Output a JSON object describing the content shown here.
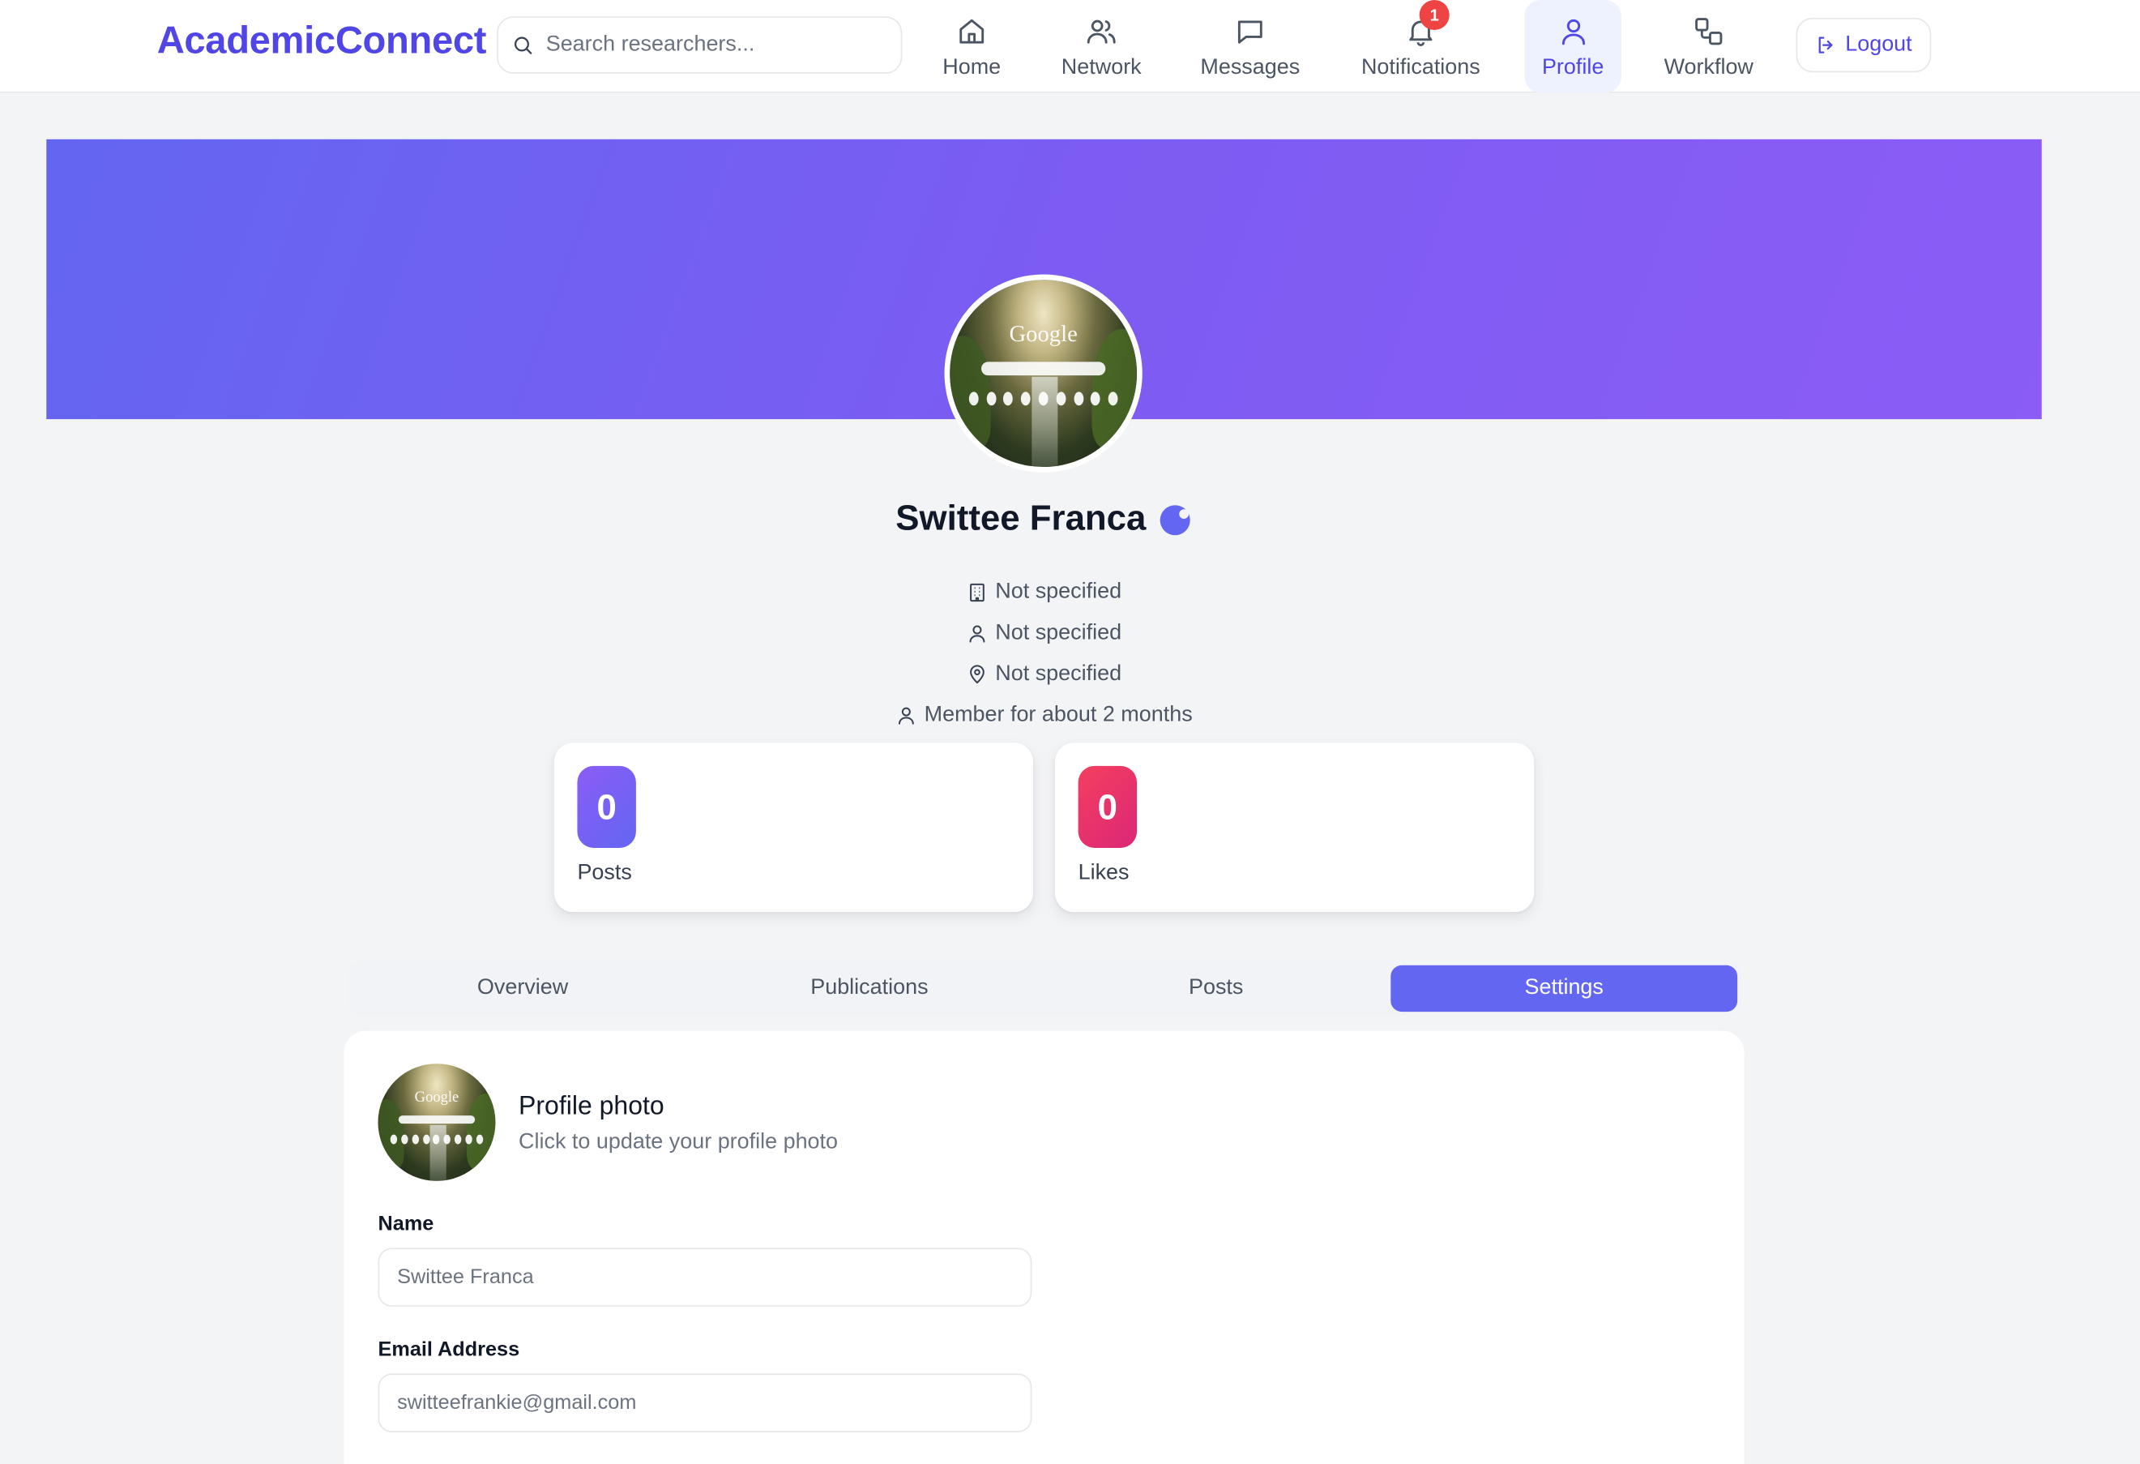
{
  "app": {
    "brand": "AcademicConnect"
  },
  "search": {
    "placeholder": "Search researchers..."
  },
  "nav": {
    "items": [
      {
        "label": "Home",
        "icon": "home-icon"
      },
      {
        "label": "Network",
        "icon": "users-icon"
      },
      {
        "label": "Messages",
        "icon": "message-icon"
      },
      {
        "label": "Notifications",
        "icon": "bell-icon",
        "badge": "1"
      },
      {
        "label": "Profile",
        "icon": "user-icon",
        "active": true
      },
      {
        "label": "Workflow",
        "icon": "workflow-icon"
      }
    ],
    "logout_label": "Logout"
  },
  "profile": {
    "photo_text": "Google",
    "name": "Swittee Franca",
    "verified_icon": "verified-badge-icon",
    "institution": "Not specified",
    "position": "Not specified",
    "location": "Not specified",
    "member_since": "Member for about 2 months"
  },
  "stats": [
    {
      "value": "0",
      "label": "Posts",
      "color_from": "#8b5cf6",
      "color_to": "#6366f1"
    },
    {
      "value": "0",
      "label": "Likes",
      "color_from": "#f43f5e",
      "color_to": "#db2777"
    }
  ],
  "tabs": [
    {
      "label": "Overview"
    },
    {
      "label": "Publications"
    },
    {
      "label": "Posts"
    },
    {
      "label": "Settings",
      "active": true
    }
  ],
  "settings": {
    "photo_title": "Profile photo",
    "photo_subtitle": "Click to update your profile photo",
    "name_label": "Name",
    "name_value": "Swittee Franca",
    "email_label": "Email Address",
    "email_value": "switteefrankie@gmail.com"
  },
  "colors": {
    "accent": "#4f46e5",
    "accent_soft": "#eef2ff",
    "tab_active": "#6366f1",
    "cover_start": "#6366f1",
    "cover_end": "#8b5cf6",
    "badge": "#ef4444"
  }
}
